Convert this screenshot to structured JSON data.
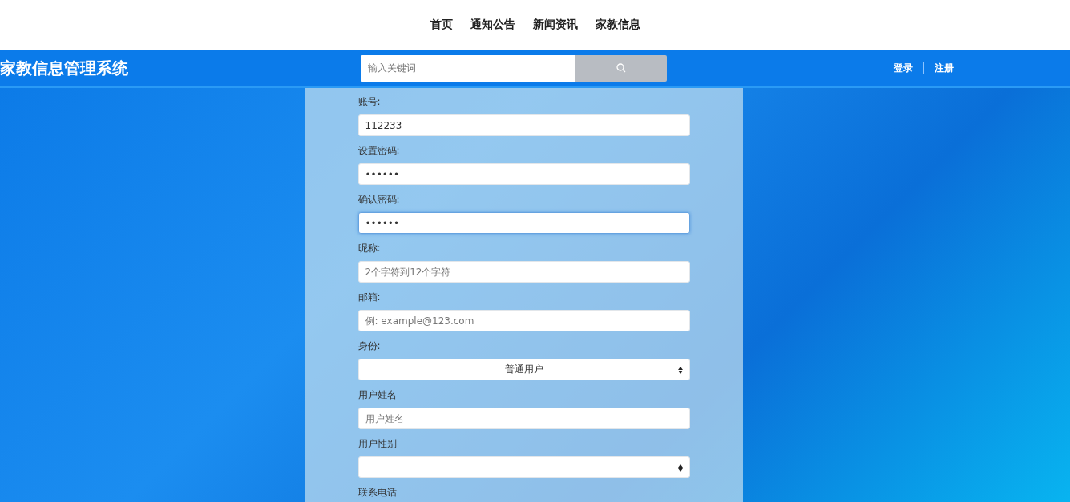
{
  "nav": {
    "items": [
      {
        "label": "首页"
      },
      {
        "label": "通知公告"
      },
      {
        "label": "新闻资讯"
      },
      {
        "label": "家教信息"
      }
    ]
  },
  "header": {
    "title": "家教信息管理系统",
    "search": {
      "placeholder": "输入关键词"
    },
    "links": [
      {
        "label": "登录"
      },
      {
        "label": "注册"
      }
    ]
  },
  "form": {
    "fields": [
      {
        "label": "账号:",
        "kind": "text",
        "value": "112233",
        "focused": false
      },
      {
        "label": "设置密码:",
        "kind": "text",
        "value": "••••••",
        "focused": false
      },
      {
        "label": "确认密码:",
        "kind": "text",
        "value": "••••••",
        "focused": true
      },
      {
        "label": "昵称:",
        "kind": "text",
        "placeholder": "2个字符到12个字符",
        "focused": false
      },
      {
        "label": "邮箱:",
        "kind": "text",
        "placeholder": "例: example@123.com",
        "focused": false
      },
      {
        "label": "身份:",
        "kind": "select",
        "value": "普通用户",
        "focused": false
      },
      {
        "label": "用户姓名",
        "kind": "text",
        "placeholder": "用户姓名",
        "focused": false
      },
      {
        "label": "用户性别",
        "kind": "select",
        "focused": false
      },
      {
        "label": "联系电话",
        "kind": "label"
      }
    ]
  }
}
